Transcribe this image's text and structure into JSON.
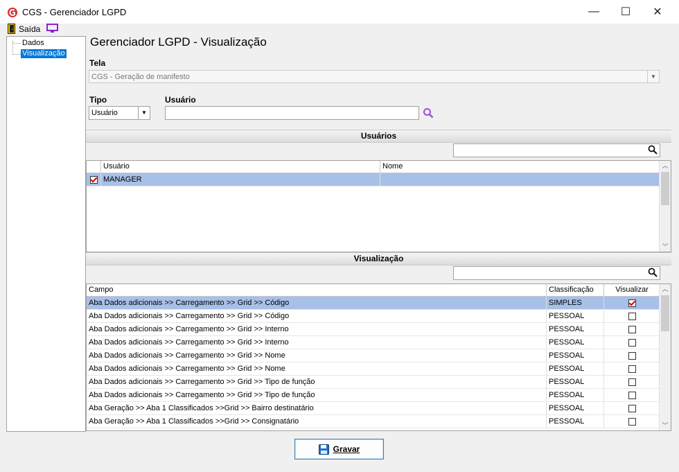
{
  "window": {
    "title": "CGS - Gerenciador LGPD",
    "minimize": "—",
    "maximize": "☐",
    "close": "✕"
  },
  "menu": {
    "exit_label": "Saída"
  },
  "tree": {
    "items": [
      {
        "label": "Dados"
      },
      {
        "label": "Visualização",
        "selected": true
      }
    ]
  },
  "page_title": "Gerenciador LGPD - Visualização",
  "tela": {
    "label": "Tela",
    "value": "CGS - Geração de manifesto"
  },
  "tipo": {
    "label": "Tipo",
    "value": "Usuário"
  },
  "usuario": {
    "label": "Usuário",
    "value": ""
  },
  "usuarios_section": {
    "title": "Usuários",
    "search_value": "",
    "columns": [
      "Usuário",
      "Nome"
    ],
    "rows": [
      {
        "checked": true,
        "usuario": "MANAGER",
        "nome": ""
      }
    ]
  },
  "visualizacao_section": {
    "title": "Visualização",
    "search_value": "",
    "columns": [
      "Campo",
      "Classificação",
      "Visualizar"
    ],
    "rows": [
      {
        "campo": "Aba Dados adicionais >> Carregamento >> Grid >> Código",
        "classificacao": "SIMPLES",
        "visualizar": true
      },
      {
        "campo": "Aba Dados adicionais >> Carregamento >> Grid >> Código",
        "classificacao": "PESSOAL",
        "visualizar": false
      },
      {
        "campo": "Aba Dados adicionais >> Carregamento >> Grid >> Interno",
        "classificacao": "PESSOAL",
        "visualizar": false
      },
      {
        "campo": "Aba Dados adicionais >> Carregamento >> Grid >> Interno",
        "classificacao": "PESSOAL",
        "visualizar": false
      },
      {
        "campo": "Aba Dados adicionais >> Carregamento >> Grid >> Nome",
        "classificacao": "PESSOAL",
        "visualizar": false
      },
      {
        "campo": "Aba Dados adicionais >> Carregamento >> Grid >> Nome",
        "classificacao": "PESSOAL",
        "visualizar": false
      },
      {
        "campo": "Aba Dados adicionais >> Carregamento >> Grid >> Tipo de função",
        "classificacao": "PESSOAL",
        "visualizar": false
      },
      {
        "campo": "Aba Dados adicionais >> Carregamento >> Grid >> Tipo de função",
        "classificacao": "PESSOAL",
        "visualizar": false
      },
      {
        "campo": "Aba Geração >> Aba 1 Classificados >>Grid >> Bairro destinatário",
        "classificacao": "PESSOAL",
        "visualizar": false
      },
      {
        "campo": "Aba Geração >> Aba 1 Classificados >>Grid >> Consignatário",
        "classificacao": "PESSOAL",
        "visualizar": false
      }
    ]
  },
  "save_button": {
    "label": "Gravar"
  },
  "colors": {
    "selected_row": "#a7c0e8",
    "tree_selection": "#0078d7",
    "check_mark": "#dd0000",
    "search_icon_purple": "#9b4fd6"
  }
}
